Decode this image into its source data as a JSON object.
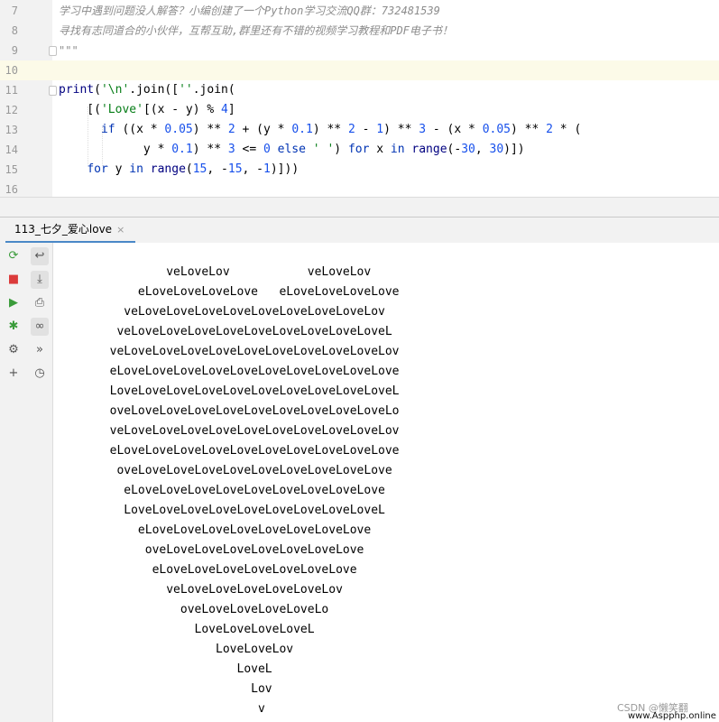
{
  "editor": {
    "lines": [
      {
        "num": "7",
        "text": "学习中遇到问题没人解答？小编创建了一个Python学习交流QQ群：732481539"
      },
      {
        "num": "8",
        "text": "寻找有志同道合的小伙伴，互帮互助,群里还有不错的视频学习教程和PDF电子书！"
      },
      {
        "num": "9",
        "text": "\"\"\""
      },
      {
        "num": "10",
        "text": ""
      },
      {
        "num": "11",
        "text": "print('\\n'.join([''.join("
      },
      {
        "num": "12",
        "text": "    [('Love'[(x - y) % 4]"
      },
      {
        "num": "13",
        "text": "      if ((x * 0.05) ** 2 + (y * 0.1) ** 2 - 1) ** 3 - (x * 0.05) ** 2 * ("
      },
      {
        "num": "14",
        "text": "            y * 0.1) ** 3 <= 0 else ' ') for x in range(-30, 30)])"
      },
      {
        "num": "15",
        "text": "    for y in range(15, -15, -1)]))"
      },
      {
        "num": "16",
        "text": ""
      }
    ]
  },
  "run_panel": {
    "tab_label": "113_七夕_爱心love",
    "tab_close": "×",
    "toolbar": [
      {
        "icon": "rerun-icon",
        "glyph": "⟳",
        "color": "#3a9b3a"
      },
      {
        "icon": "soft-wrap-icon",
        "glyph": "↩",
        "color": "#555555"
      },
      {
        "icon": "stop-icon",
        "glyph": "■",
        "color": "#db3b3b"
      },
      {
        "icon": "scroll-to-end-icon",
        "glyph": "⤓",
        "color": "#555555"
      },
      {
        "icon": "run-icon",
        "glyph": "▶",
        "color": "#3a9b3a"
      },
      {
        "icon": "print-icon",
        "glyph": "⎙",
        "color": "#555555"
      },
      {
        "icon": "debug-icon",
        "glyph": "✱",
        "color": "#3a9b3a"
      },
      {
        "icon": "view-breakpoints-icon",
        "glyph": "∞",
        "color": "#555555"
      },
      {
        "icon": "settings-icon",
        "glyph": "⚙",
        "color": "#555555"
      },
      {
        "icon": "more-actions-icon",
        "glyph": "»",
        "color": "#555555"
      },
      {
        "icon": "add-icon",
        "glyph": "+",
        "color": "#555555"
      },
      {
        "icon": "history-icon",
        "glyph": "◷",
        "color": "#555555"
      }
    ],
    "output_lines": [
      "",
      "                veLoveLov           veLoveLov",
      "            eLoveLoveLoveLove   eLoveLoveLoveLove",
      "          veLoveLoveLoveLoveLoveLoveLoveLoveLov",
      "         veLoveLoveLoveLoveLoveLoveLoveLoveLoveL",
      "        veLoveLoveLoveLoveLoveLoveLoveLoveLoveLov",
      "        eLoveLoveLoveLoveLoveLoveLoveLoveLoveLove",
      "        LoveLoveLoveLoveLoveLoveLoveLoveLoveLoveL",
      "        oveLoveLoveLoveLoveLoveLoveLoveLoveLoveLo",
      "        veLoveLoveLoveLoveLoveLoveLoveLoveLoveLov",
      "        eLoveLoveLoveLoveLoveLoveLoveLoveLoveLove",
      "         oveLoveLoveLoveLoveLoveLoveLoveLoveLove",
      "          eLoveLoveLoveLoveLoveLoveLoveLoveLove",
      "          LoveLoveLoveLoveLoveLoveLoveLoveLoveL",
      "            eLoveLoveLoveLoveLoveLoveLoveLove",
      "             oveLoveLoveLoveLoveLoveLoveLove",
      "              eLoveLoveLoveLoveLoveLoveLove",
      "                veLoveLoveLoveLoveLoveLov",
      "                  oveLoveLoveLoveLoveLo",
      "                    LoveLoveLoveLoveL",
      "                       LoveLoveLov",
      "                          LoveL",
      "                            Lov",
      "                             v"
    ]
  },
  "watermark": {
    "line1": "CSDN @懒笑翻",
    "line2": "www.Aspphp.online"
  },
  "colors": {
    "comment": "#8c8c8c",
    "keyword": "#0033b3",
    "string": "#067d17",
    "number": "#1750eb",
    "current_line": "#fcfae8",
    "tab_underline": "#4a88c7"
  }
}
